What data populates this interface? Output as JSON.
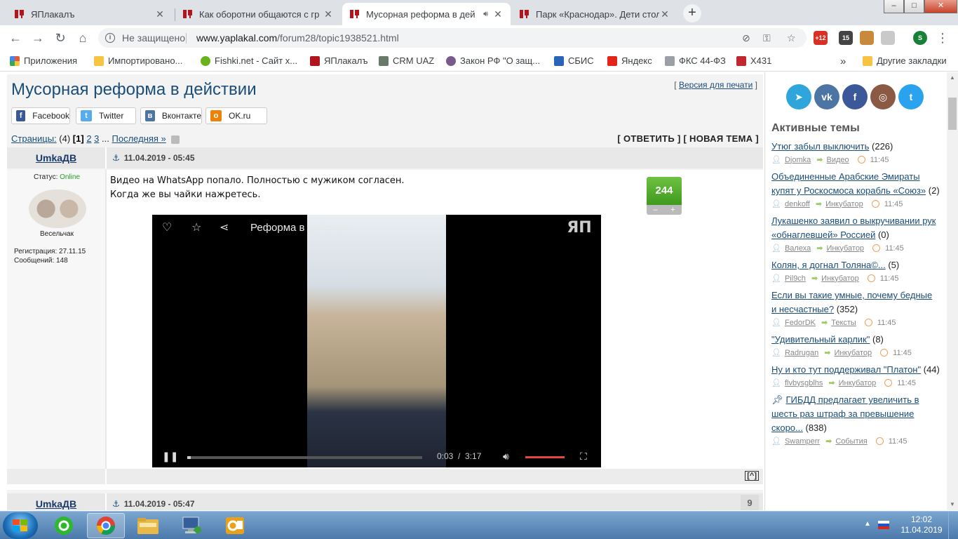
{
  "tabs": [
    {
      "title": "ЯПлакалъ",
      "active": false
    },
    {
      "title": "Как оборотни общаются с гр",
      "active": false
    },
    {
      "title": "Мусорная реформа в дей",
      "active": true,
      "sound": true
    },
    {
      "title": "Парк «Краснодар». Дети стол",
      "active": false
    }
  ],
  "new_tab_label": "+",
  "window_controls": {
    "minimize": "–",
    "maximize": "□",
    "close": "✕"
  },
  "toolbar": {
    "security_label": "Не защищено",
    "url_host": "www.yaplakal.com",
    "url_path": "/forum28/topic1938521.html",
    "ext_badges": [
      "+12",
      "15"
    ],
    "profile_letter": "S"
  },
  "bookmarks": [
    {
      "label": "Приложения",
      "color": "#e25a3b"
    },
    {
      "label": "Импортировано...",
      "color": "#f6c342"
    },
    {
      "label": "Fishki.net - Сайт х...",
      "color": "#68b31d"
    },
    {
      "label": "ЯПлакалъ",
      "color": "#b3151c"
    },
    {
      "label": "CRM UAZ",
      "color": "#6a7a6a"
    },
    {
      "label": "Закон РФ \"О защ...",
      "color": "#7a5a8a"
    },
    {
      "label": "СБИС",
      "color": "#2a64b8"
    },
    {
      "label": "Яндекс",
      "color": "#e2241b"
    },
    {
      "label": "ФКС 44-ФЗ",
      "color": "#9aa0a6"
    },
    {
      "label": "X431",
      "color": "#c0282d"
    }
  ],
  "bookmarks_more": "»",
  "other_bookmarks": "Другие закладки",
  "topic": {
    "title": "Мусорная реформа в действии",
    "print_label": "Версия для печати"
  },
  "share_buttons": [
    {
      "label": "Facebook",
      "icon": "f",
      "color": "#3b5998"
    },
    {
      "label": "Twitter",
      "icon": "t",
      "color": "#55acee"
    },
    {
      "label": "Вконтакте",
      "icon": "в",
      "color": "#4c75a3"
    },
    {
      "label": "OK.ru",
      "icon": "о",
      "color": "#ee8208"
    }
  ],
  "pager": {
    "label": "Страницы:",
    "count": "(4)",
    "current": "[1]",
    "p2": "2",
    "p3": "3",
    "ellipsis": "...",
    "last": "Последняя »"
  },
  "actions": {
    "reply": "[ ОТВЕТИТЬ ]",
    "new_topic": "[ НОВАЯ ТЕМА ]"
  },
  "post1": {
    "author": "UmkaДВ",
    "date": "11.04.2019 - 05:45",
    "status_label": "Статус:",
    "status_value": "Online",
    "rank": "Весельчак",
    "registered": "Регистрация: 27.11.15",
    "messages": "Сообщений: 148",
    "text_line1": "Видео на WhatsApp попало. Полностью с мужиком согласен.",
    "text_line2": "Когда же вы чайки нажретесь.",
    "rating": "244",
    "rating_minus": "–",
    "rating_plus": "+",
    "to_top": "[^]"
  },
  "video": {
    "title": "Реформа в действии",
    "logo": "ЯП",
    "time_current": "0:03",
    "time_sep": "/",
    "time_total": "3:17",
    "progress": 0.015
  },
  "post2": {
    "author": "UmkaДВ",
    "date": "11.04.2019 - 05:47",
    "number": "9"
  },
  "sidebar": {
    "social": [
      {
        "name": "telegram",
        "glyph": "➤",
        "color": "#2ea6dc"
      },
      {
        "name": "vk",
        "glyph": "vk",
        "color": "#4c75a3"
      },
      {
        "name": "facebook",
        "glyph": "f",
        "color": "#3b5998"
      },
      {
        "name": "instagram",
        "glyph": "◎",
        "color": "#8a5a44"
      },
      {
        "name": "twitter",
        "glyph": "t",
        "color": "#2aa3ef"
      }
    ],
    "title": "Активные темы",
    "topics": [
      {
        "title": "Утюг забыл выключить",
        "count": "(226)",
        "user": "Djomka",
        "section": "Видео",
        "time": "11:45",
        "pinned": false
      },
      {
        "title": "Объединенные Арабские Эмираты купят у Роскосмоса корабль «Союз»",
        "count": "(2)",
        "user": "denkoff",
        "section": "Инкубатор",
        "time": "11:45",
        "pinned": false
      },
      {
        "title": "Лукашенко заявил о выкручивании рук «обнаглевшей» Россией",
        "count": "(0)",
        "user": "Валеха",
        "section": "Инкубатор",
        "time": "11:45",
        "pinned": false
      },
      {
        "title": "Колян, я догнал Толяна©...",
        "count": "(5)",
        "user": "Pil9ch",
        "section": "Инкубатор",
        "time": "11:45",
        "pinned": false
      },
      {
        "title": "Если вы такие умные, почему бедные и несчастные?",
        "count": "(352)",
        "user": "FedorDK",
        "section": "Тексты",
        "time": "11:45",
        "pinned": false
      },
      {
        "title": "\"Удивительный карлик\"",
        "count": "(8)",
        "user": "Radrugan",
        "section": "Инкубатор",
        "time": "11:45",
        "pinned": false
      },
      {
        "title": "Ну и кто тут поддерживал \"Платон\"",
        "count": "(44)",
        "user": "flvbysgblhs",
        "section": "Инкубатор",
        "time": "11:45",
        "pinned": false
      },
      {
        "title": "ГИБДД предлагает увеличить в шесть раз штраф за превышение скоро...",
        "count": "(838)",
        "user": "Swamperr",
        "section": "События",
        "time": "11:45",
        "pinned": true
      }
    ]
  },
  "taskbar": {
    "time": "12:02",
    "date": "11.04.2019"
  }
}
